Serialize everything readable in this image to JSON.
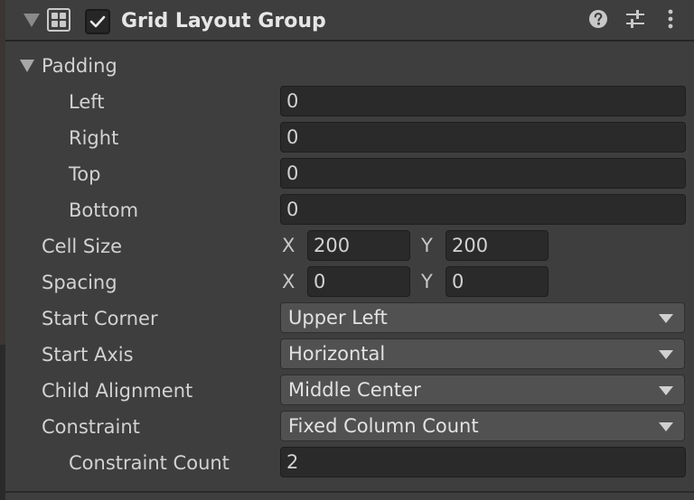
{
  "component": {
    "title": "Grid Layout Group",
    "enabled": true,
    "header_icons": [
      "help-icon",
      "preset-sliders-icon",
      "more-vertical-icon"
    ]
  },
  "padding": {
    "label": "Padding",
    "left_label": "Left",
    "left_value": "0",
    "right_label": "Right",
    "right_value": "0",
    "top_label": "Top",
    "top_value": "0",
    "bottom_label": "Bottom",
    "bottom_value": "0"
  },
  "cell_size": {
    "label": "Cell Size",
    "x_label": "X",
    "x_value": "200",
    "y_label": "Y",
    "y_value": "200"
  },
  "spacing": {
    "label": "Spacing",
    "x_label": "X",
    "x_value": "0",
    "y_label": "Y",
    "y_value": "0"
  },
  "start_corner": {
    "label": "Start Corner",
    "value": "Upper Left"
  },
  "start_axis": {
    "label": "Start Axis",
    "value": "Horizontal"
  },
  "child_alignment": {
    "label": "Child Alignment",
    "value": "Middle Center"
  },
  "constraint": {
    "label": "Constraint",
    "value": "Fixed Column Count"
  },
  "constraint_count": {
    "label": "Constraint Count",
    "value": "2"
  }
}
